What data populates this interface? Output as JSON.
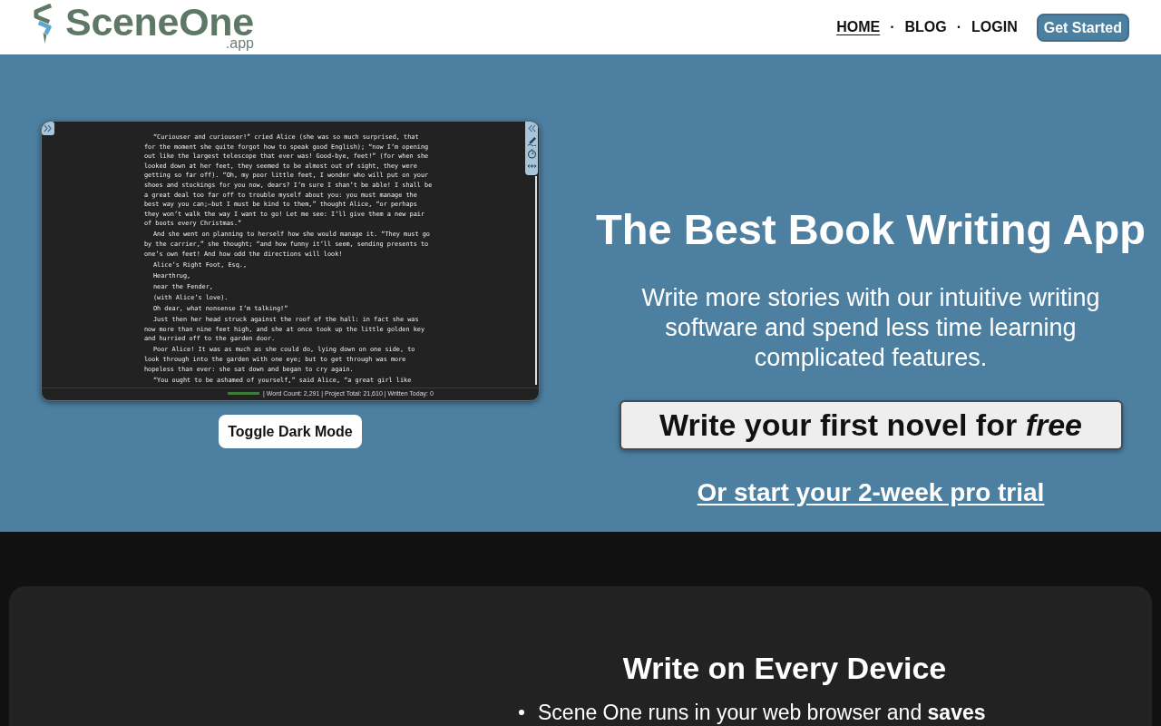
{
  "header": {
    "logo": {
      "name": "SceneOne",
      "suffix": ".app"
    },
    "nav": [
      {
        "label": "HOME",
        "selected": true
      },
      {
        "label": "BLOG",
        "selected": false
      },
      {
        "label": "LOGIN",
        "selected": false
      }
    ],
    "nav_separators": [
      "·",
      "·"
    ],
    "cta": "Get Started"
  },
  "hero": {
    "editor": {
      "paragraphs": [
        {
          "lines": [
            "“Curiouser and curiouser!” cried Alice (she was so much surprised, that",
            "for the moment she quite forgot how to speak good English); “now I’m opening",
            "out like the largest telescope that ever was! Good-bye, feet!” (for when she",
            "looked down at her feet, they seemed to be almost out of sight, they were",
            "getting so far off). “Oh, my poor little feet, I wonder who will put on your",
            "shoes and stockings for you now, dears? I’m sure I shan’t be able! I shall be",
            "a great deal too far off to trouble myself about you: you must manage the",
            "best way you can;—but I must be kind to them,” thought Alice, “or perhaps",
            "they won’t walk the way I want to go! Let me see: I’ll give them a new pair",
            "of boots every Christmas.”"
          ]
        },
        {
          "lines": [
            "And she went on planning to herself how she would manage it. “They must go",
            "by the carrier,” she thought; “and how funny it’ll seem, sending presents to",
            "one’s own feet! And how odd the directions will look!"
          ]
        },
        {
          "lines": [
            "Alice’s Right Foot, Esq.,"
          ]
        },
        {
          "lines": [
            "Hearthrug,"
          ]
        },
        {
          "lines": [
            "near the Fender,"
          ]
        },
        {
          "lines": [
            "(with Alice’s love)."
          ]
        },
        {
          "lines": [
            "Oh dear, what nonsense I’m talking!”"
          ]
        },
        {
          "lines": [
            "Just then her head struck against the roof of the hall: in fact she was",
            "now more than nine feet high, and she at once took up the little golden key",
            "and hurried off to the garden door."
          ]
        },
        {
          "lines": [
            "Poor Alice! It was as much as she could do, lying down on one side, to",
            "look through into the garden with one eye; but to get through was more",
            "hopeless than ever: she sat down and began to cry again."
          ]
        },
        {
          "lines": [
            "“You ought to be ashamed of yourself,” said Alice, “a great girl like"
          ]
        }
      ],
      "status_bar": {
        "progress": {
          "level": 1
        },
        "text": "| Word Count: 2,291 | Project Total: 21,610 | Written Today: 0"
      }
    },
    "toggle_button": "Toggle Dark Mode",
    "title": "The Best Book Writing App",
    "subtitle": "Write more stories with our intuitive writing software and spend less time learning complicated features.",
    "primary_button": "Write your first novel for *free*",
    "trial_link": "Or start your 2-week pro trial"
  },
  "features": {
    "title": "Write on Every Device",
    "bullets": [
      "Scene One runs in your web browser and **saves**"
    ]
  }
}
